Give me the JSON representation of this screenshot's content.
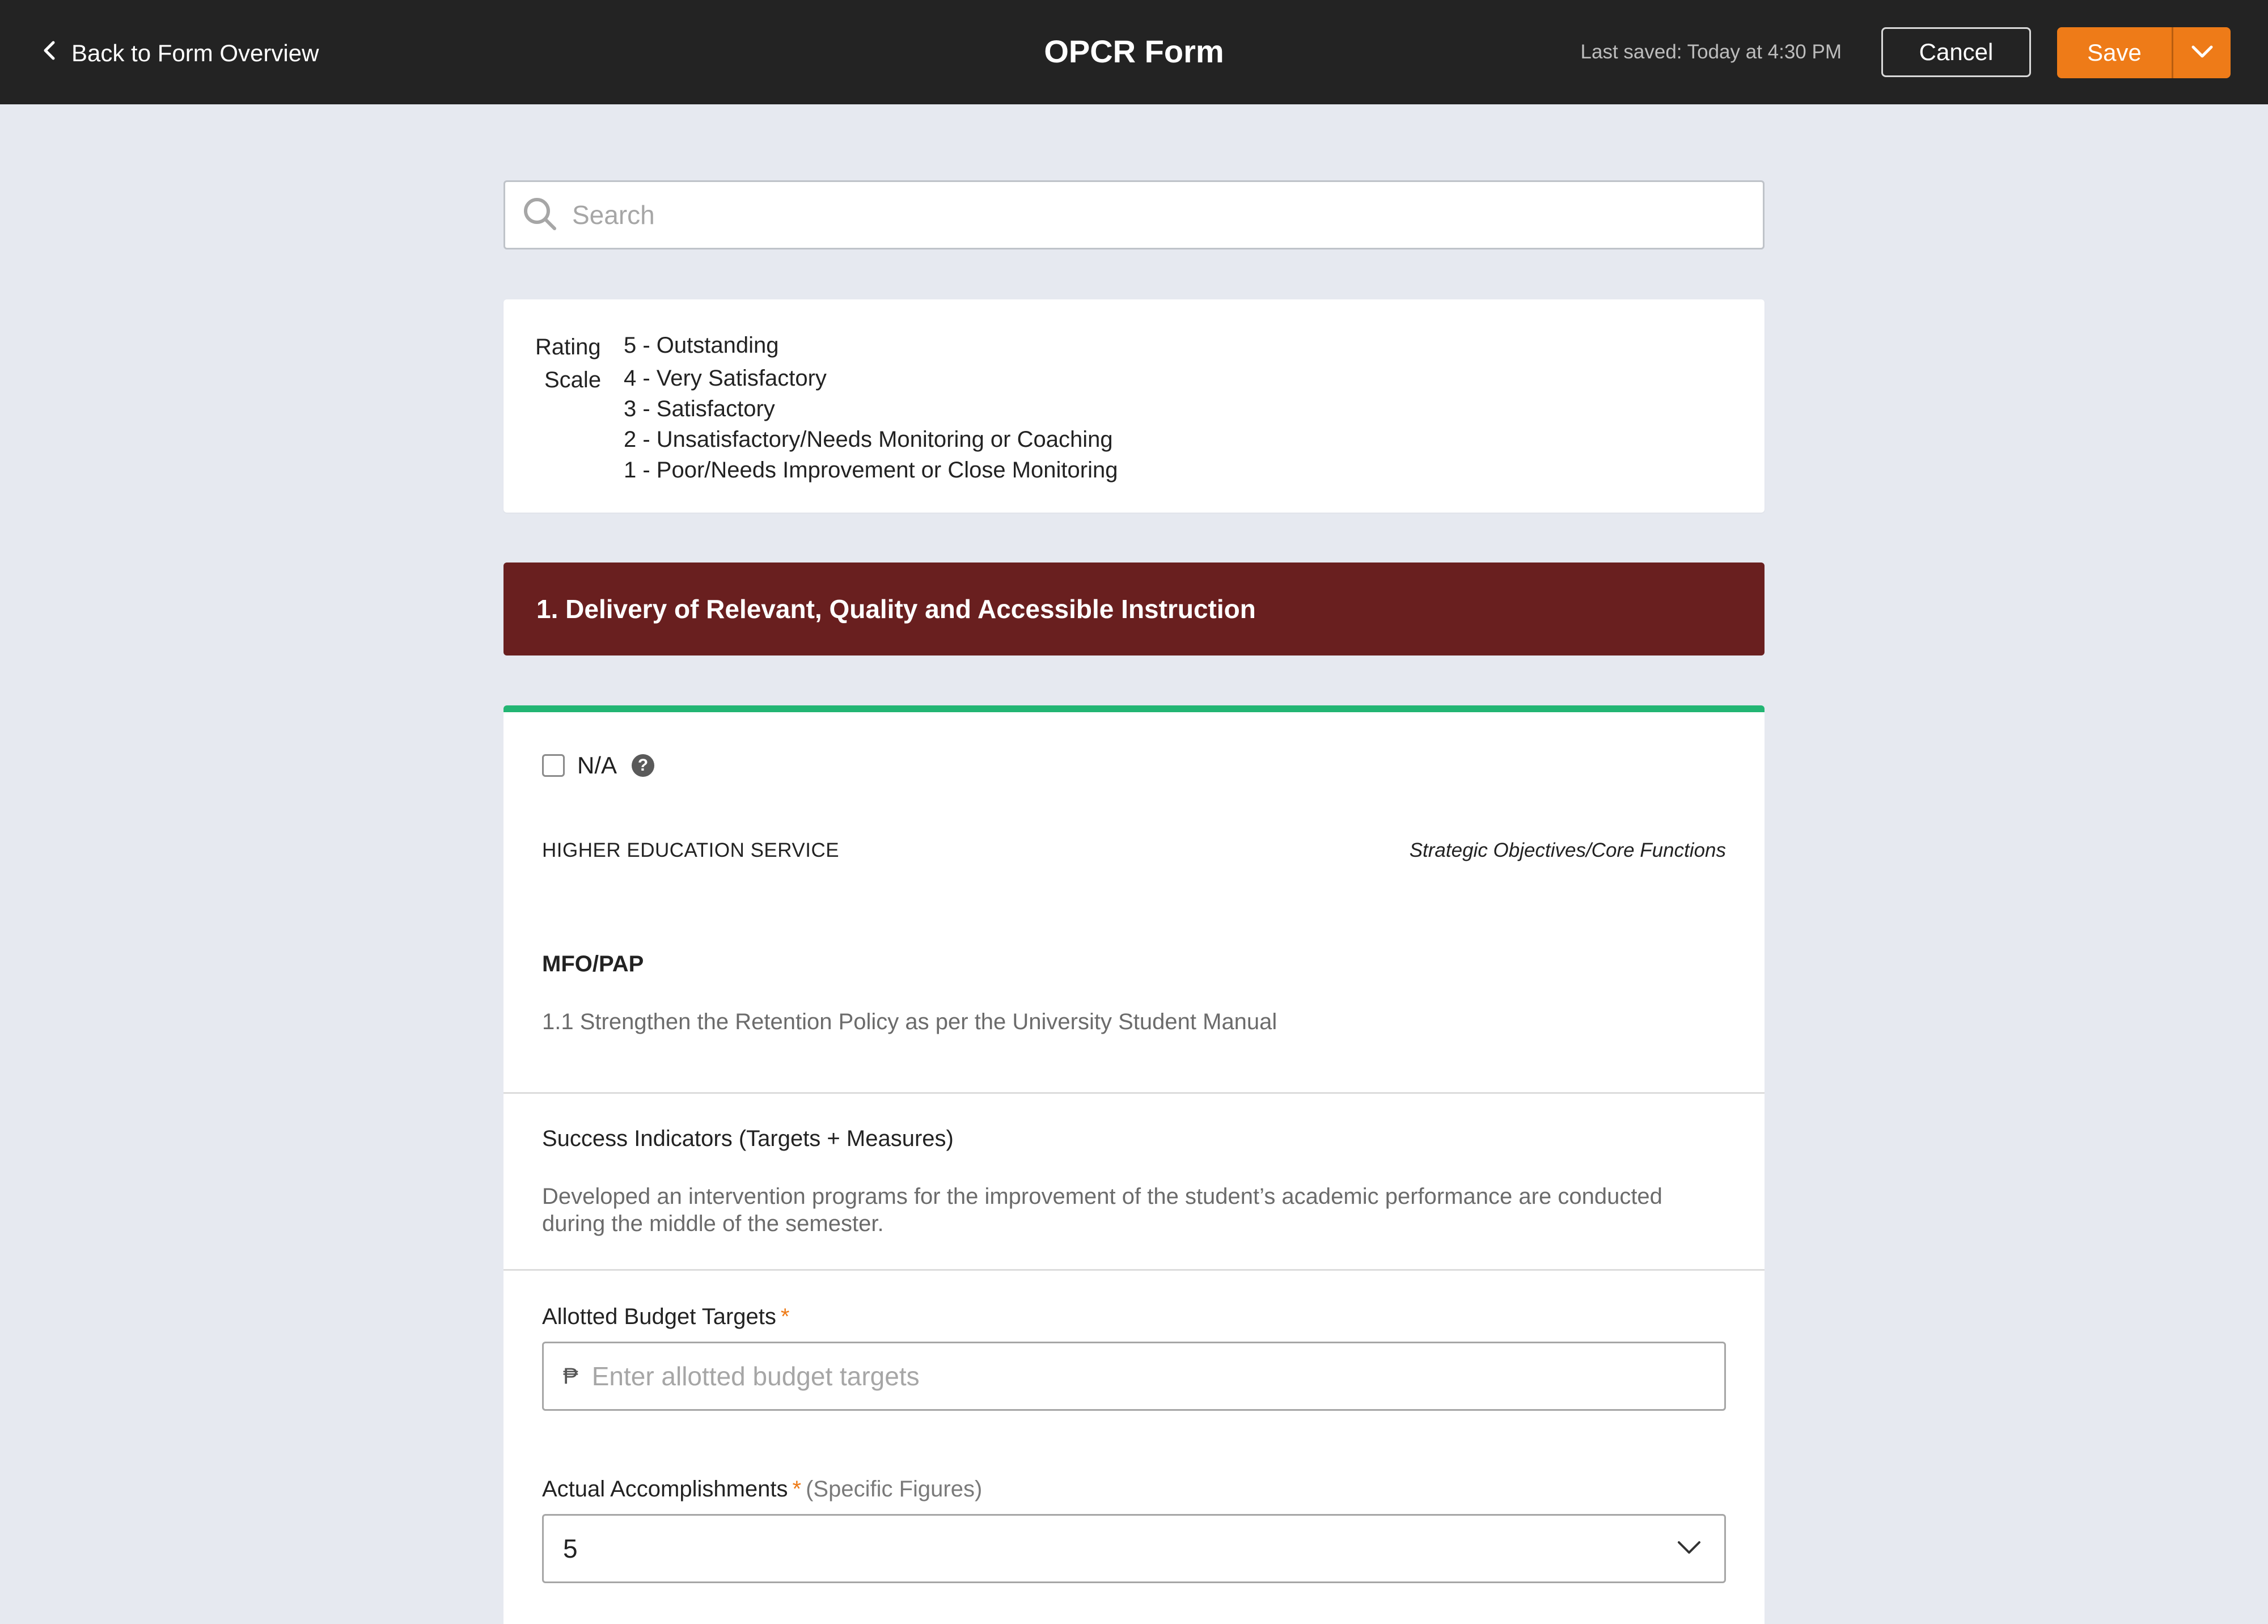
{
  "topbar": {
    "back_label": "Back to Form Overview",
    "title": "OPCR Form",
    "last_saved": "Last saved: Today at 4:30 PM",
    "cancel_label": "Cancel",
    "save_label": "Save"
  },
  "search": {
    "placeholder": "Search"
  },
  "rating_scale": {
    "label_line1": "Rating",
    "label_line2": "Scale",
    "items": [
      "5 - Outstanding",
      "4 - Very Satisfactory",
      "3 - Satisfactory",
      "2 - Unsatisfactory/Needs Monitoring or Coaching",
      "1 - Poor/Needs Improvement or Close Monitoring"
    ]
  },
  "section": {
    "title": "1. Delivery of Relevant, Quality and Accessible Instruction"
  },
  "card": {
    "accent_color": "#22b573",
    "na_label": "N/A",
    "na_checked": false,
    "help_glyph": "?",
    "service_label": "HIGHER EDUCATION SERVICE",
    "objectives_label": "Strategic Objectives/Core Functions",
    "mfo_title": "MFO/PAP",
    "mfo_text": "1.1 Strengthen the Retention Policy as per the University Student Manual",
    "success_title": "Success Indicators (Targets + Measures)",
    "success_text": "Developed an intervention programs for the improvement of the student’s academic performance are conducted during the middle of the semester.",
    "budget_label": "Allotted Budget Targets",
    "required_mark": "*",
    "currency_symbol": "₱",
    "budget_placeholder": "Enter allotted budget targets",
    "accomplishments_label": "Actual Accomplishments",
    "accomplishments_hint": "(Specific Figures)",
    "accomplishments_value": "5"
  },
  "colors": {
    "topbar": "#232323",
    "save": "#ee7b18",
    "section": "#691f1f",
    "background": "#e6e9f0"
  }
}
